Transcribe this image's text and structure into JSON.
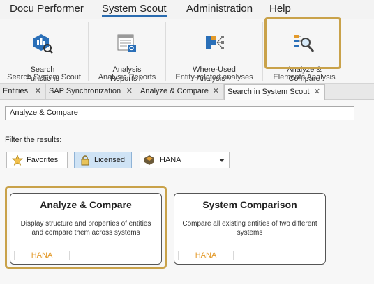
{
  "menu": {
    "items": [
      {
        "label": "Docu Performer"
      },
      {
        "label": "System Scout"
      },
      {
        "label": "Administration"
      },
      {
        "label": "Help"
      }
    ]
  },
  "ribbon": {
    "groups": [
      {
        "label": "Search System Scout",
        "buttons": [
          {
            "label": "Search\nFunctions",
            "icon": "search-functions-icon"
          }
        ]
      },
      {
        "label": "Analysis Reports",
        "buttons": [
          {
            "label": "Analysis\nReports ˅",
            "icon": "analysis-reports-icon"
          }
        ]
      },
      {
        "label": "Entity-related analyses",
        "buttons": [
          {
            "label": "Where-Used\nAnalysis ˅",
            "icon": "where-used-icon"
          }
        ]
      },
      {
        "label": "Elements Analysis",
        "buttons": [
          {
            "label": "Analyze &\nCompare",
            "icon": "analyze-compare-icon"
          }
        ]
      }
    ]
  },
  "tabs": [
    {
      "label": "Entities"
    },
    {
      "label": "SAP Synchronization"
    },
    {
      "label": "Analyze & Compare"
    },
    {
      "label": "Search in System Scout"
    }
  ],
  "search": {
    "value": "Analyze & Compare"
  },
  "filter": {
    "label": "Filter the results:",
    "favorites": "Favorites",
    "licensed": "Licensed",
    "combo_value": "HANA"
  },
  "cards": [
    {
      "title": "Analyze & Compare",
      "description": "Display structure and properties of entities and compare them across systems",
      "tag": "HANA"
    },
    {
      "title": "System Comparison",
      "description": "Compare all existing entities of two different systems",
      "tag": "HANA"
    }
  ],
  "colors": {
    "accent": "#c9a24a",
    "tag": "#e39a2a",
    "active_menu": "#2b6cb0"
  }
}
